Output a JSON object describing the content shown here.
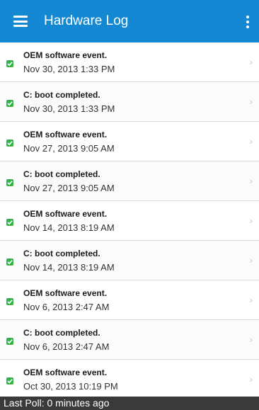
{
  "appbar": {
    "title": "Hardware Log",
    "color": "#1488d2"
  },
  "events": [
    {
      "message": "OEM software event.",
      "timestamp": "Nov 30, 2013 1:33 PM"
    },
    {
      "message": "C: boot completed.",
      "timestamp": "Nov 30, 2013 1:33 PM"
    },
    {
      "message": "OEM software event.",
      "timestamp": "Nov 27, 2013 9:05 AM"
    },
    {
      "message": "C: boot completed.",
      "timestamp": "Nov 27, 2013 9:05 AM"
    },
    {
      "message": "OEM software event.",
      "timestamp": "Nov 14, 2013 8:19 AM"
    },
    {
      "message": "C: boot completed.",
      "timestamp": "Nov 14, 2013 8:19 AM"
    },
    {
      "message": "OEM software event.",
      "timestamp": "Nov 6, 2013 2:47 AM"
    },
    {
      "message": "C: boot completed.",
      "timestamp": "Nov 6, 2013 2:47 AM"
    },
    {
      "message": "OEM software event.",
      "timestamp": "Oct 30, 2013 10:19 PM"
    }
  ],
  "status_bar": {
    "text": "Last Poll: 0 minutes ago"
  },
  "icons": {
    "menu": "hamburger-menu-icon",
    "overflow": "vertical-dots-icon",
    "status": "green-check-icon",
    "row_chevron": "chevron-right-icon"
  }
}
